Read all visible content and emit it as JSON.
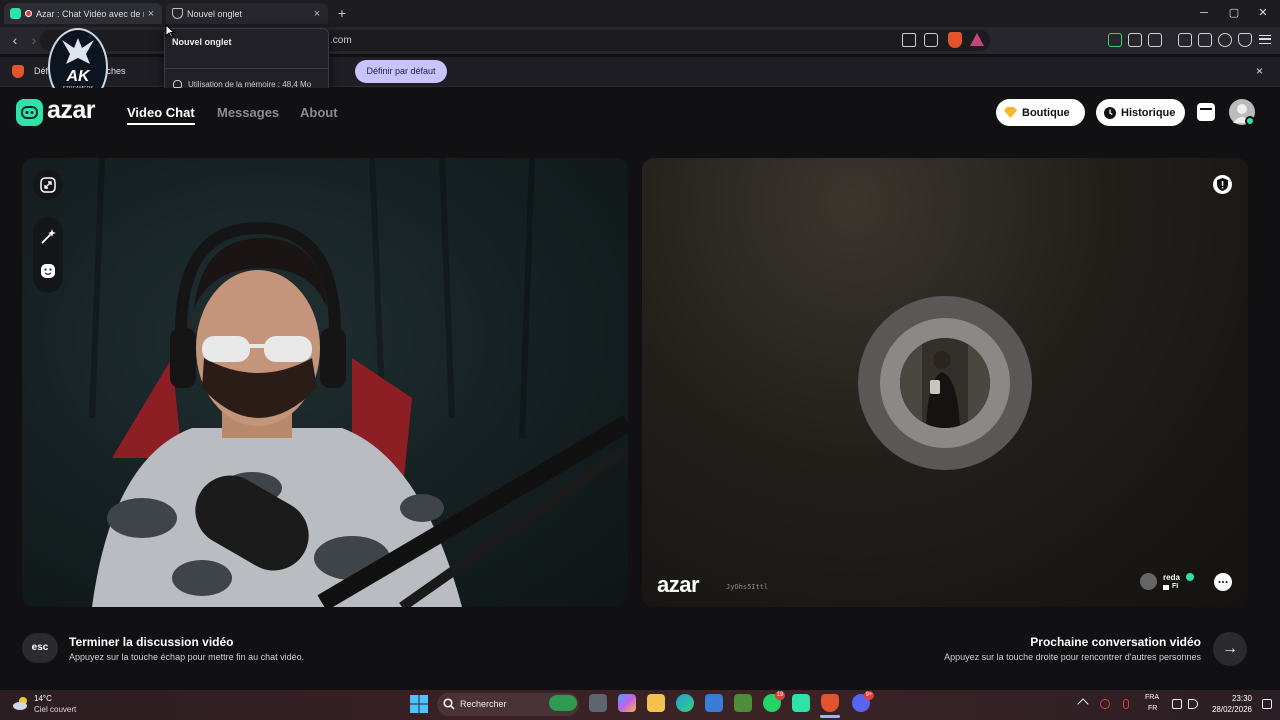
{
  "browser": {
    "tabs": [
      {
        "title": "Azar : Chat Vidéo avec de no",
        "active": true
      },
      {
        "title": "Nouvel onglet",
        "active": false
      }
    ],
    "new_tab_symbol": "+",
    "close_symbol": "×",
    "window_controls": {
      "minimize": "─",
      "maximize": "▢",
      "close": "✕"
    },
    "url_fragment": ".com",
    "infobar": {
      "text": "Défi        mme navigat                                            ches",
      "button": "Définir par défaut",
      "close": "×"
    },
    "tooltip": {
      "title": "Nouvel onglet",
      "memory": "Utilisation de la mémoire : 48,4 Mo"
    }
  },
  "watermark": {
    "text": "AK",
    "caption": "STREAMERS"
  },
  "azar": {
    "logo": "azar",
    "nav": [
      {
        "label": "Video Chat",
        "active": true
      },
      {
        "label": "Messages",
        "active": false
      },
      {
        "label": "About",
        "active": false
      }
    ],
    "header_buttons": {
      "boutique": "Boutique",
      "historique": "Historique"
    },
    "remote": {
      "watermark_logo": "azar",
      "watermark_id": "JyOhs5Ittl",
      "peer_name": "reda",
      "peer_country": "FI"
    },
    "footer": {
      "esc_key": "esc",
      "end_title": "Terminer la discussion vidéo",
      "end_subtitle": "Appuyez sur la touche échap pour mettre fin au chat vidéo.",
      "next_title": "Prochaine conversation vidéo",
      "next_subtitle": "Appuyez sur la touche droite pour rencontrer d'autres personnes",
      "next_arrow": "→"
    },
    "colors": {
      "brand": "#2ee3a9",
      "accent_pill": "#c9c3ff"
    }
  },
  "taskbar": {
    "weather_temp": "14°C",
    "weather_desc": "Ciel couvert",
    "search_label": "Rechercher",
    "badges": {
      "whatsapp": "19",
      "discord": "9+"
    },
    "lang_top": "FRA",
    "lang_bottom": "FR",
    "time": "23:30",
    "date": "28/02/2026"
  }
}
